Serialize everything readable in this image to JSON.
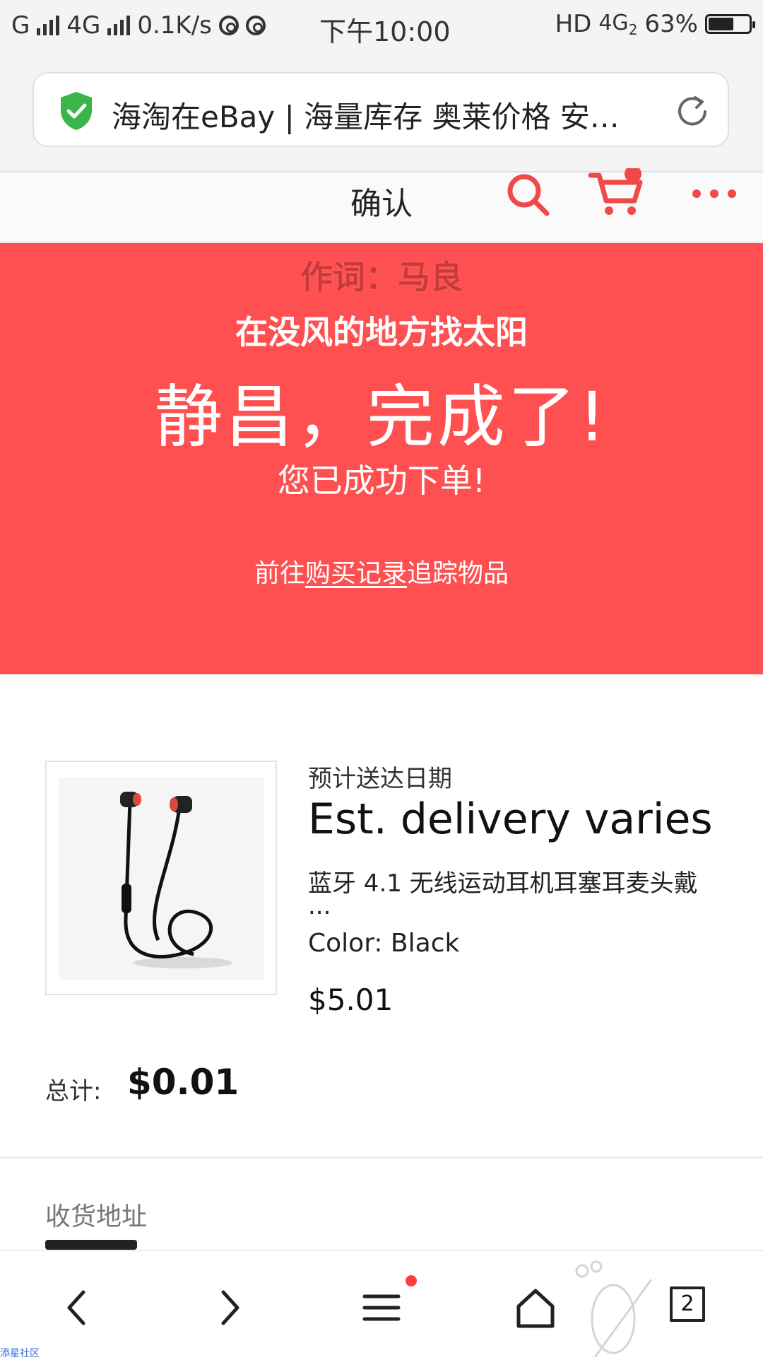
{
  "status_bar": {
    "carrier_left": "G",
    "network": "4G",
    "speed": "0.1K/s",
    "time": "下午10:00",
    "hd": "HD",
    "network_right": "4G",
    "network_right_sub": "2",
    "battery": "63%",
    "battery_level": 0.63
  },
  "browser": {
    "url_title": "海淘在eBay | 海量库存 奥莱价格 安…",
    "secure_color": "#3ab54a"
  },
  "header": {
    "title": "确认",
    "accent_color": "#f0494a",
    "icons": [
      "search-icon",
      "cart-icon",
      "more-icon"
    ]
  },
  "banner": {
    "background": "#ff5051",
    "credit": "作词：马良",
    "lyric": "在没风的地方找太阳",
    "title": "静昌，完成了!",
    "subtitle": "您已成功下单!",
    "track_prefix": "前往",
    "track_link": "购买记录",
    "track_suffix": "追踪物品"
  },
  "order_item": {
    "delivery_label": "预计送达日期",
    "delivery_value": "Est. delivery varies",
    "title": "蓝牙 4.1 无线运动耳机耳塞耳麦头戴",
    "title_ellipsis": "...",
    "color": "Color: Black",
    "price": "$5.01"
  },
  "totals": {
    "label": "总计:",
    "value": "$0.01"
  },
  "shipping": {
    "label": "收货地址"
  },
  "bottom_nav": {
    "tab_count": "2",
    "watermark_text": "添星社区"
  }
}
